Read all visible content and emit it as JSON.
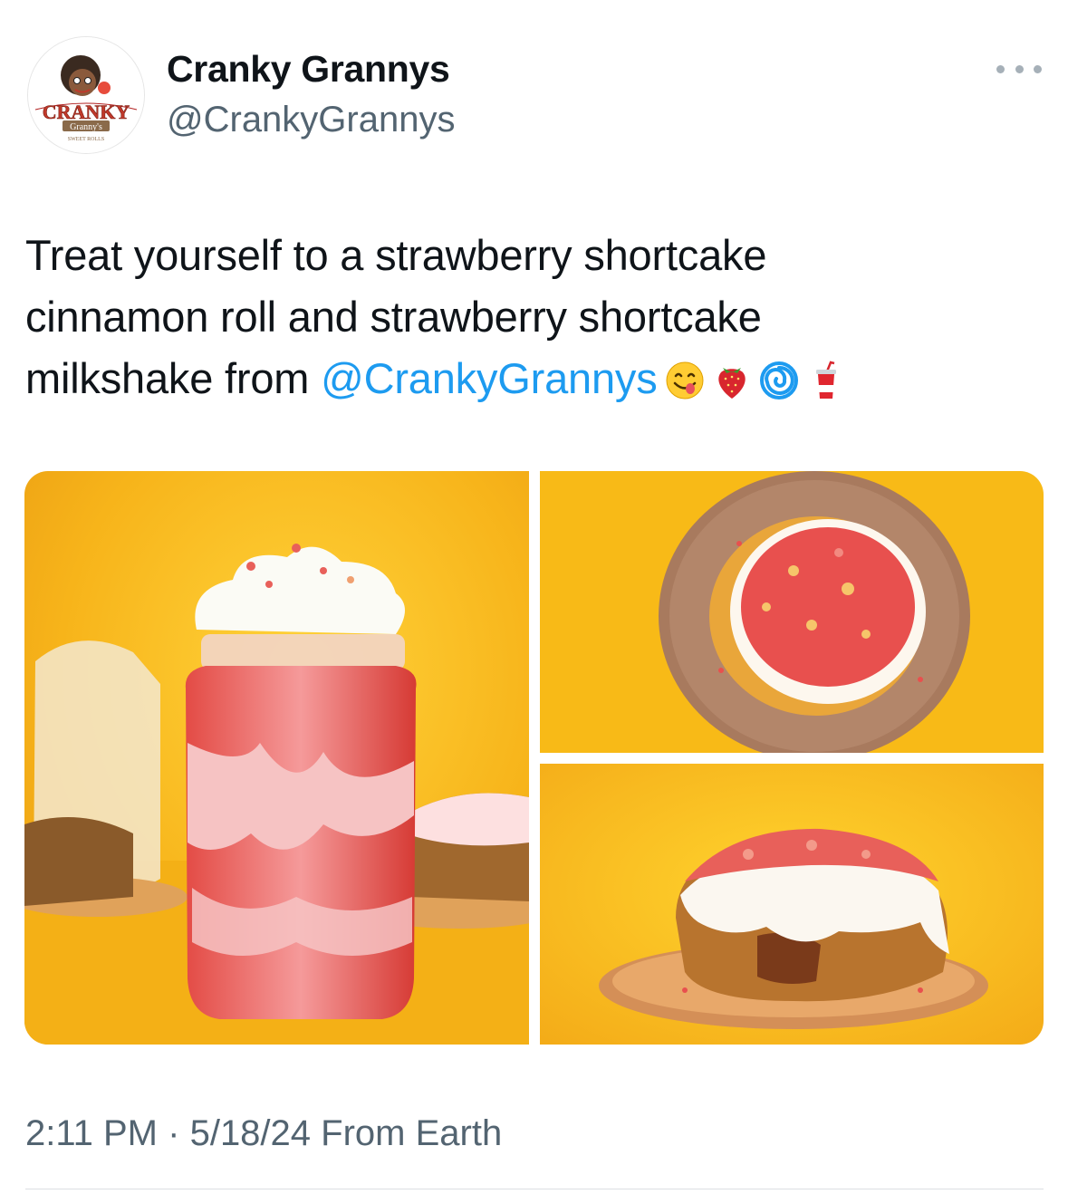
{
  "author": {
    "display_name": "Cranky Grannys",
    "handle": "@CrankyGrannys",
    "avatar_logo_text": "CRANKY Granny's SWEET ROLLS"
  },
  "tweet": {
    "text_line_1": "Treat yourself to a strawberry shortcake",
    "text_line_2": "cinnamon roll and strawberry shortcake",
    "text_line_3_prefix": "milkshake from ",
    "mention": "@CrankyGrannys",
    "emojis": [
      "face-savoring-food",
      "strawberry",
      "cyclone",
      "cup-with-straw"
    ]
  },
  "media": [
    {
      "name": "strawberry-milkshake-photo",
      "alt": "strawberry shortcake milkshake"
    },
    {
      "name": "cinnamon-roll-top-view-photo",
      "alt": "strawberry shortcake cinnamon roll top view"
    },
    {
      "name": "cinnamon-roll-side-view-photo",
      "alt": "strawberry shortcake cinnamon roll side view"
    }
  ],
  "footer": {
    "time": "2:11 PM",
    "separator": "·",
    "date": "5/18/24",
    "source": "From Earth"
  },
  "colors": {
    "mention_blue": "#1d9bf0",
    "secondary_text": "#536471",
    "photo_background": "#f7b81c"
  }
}
